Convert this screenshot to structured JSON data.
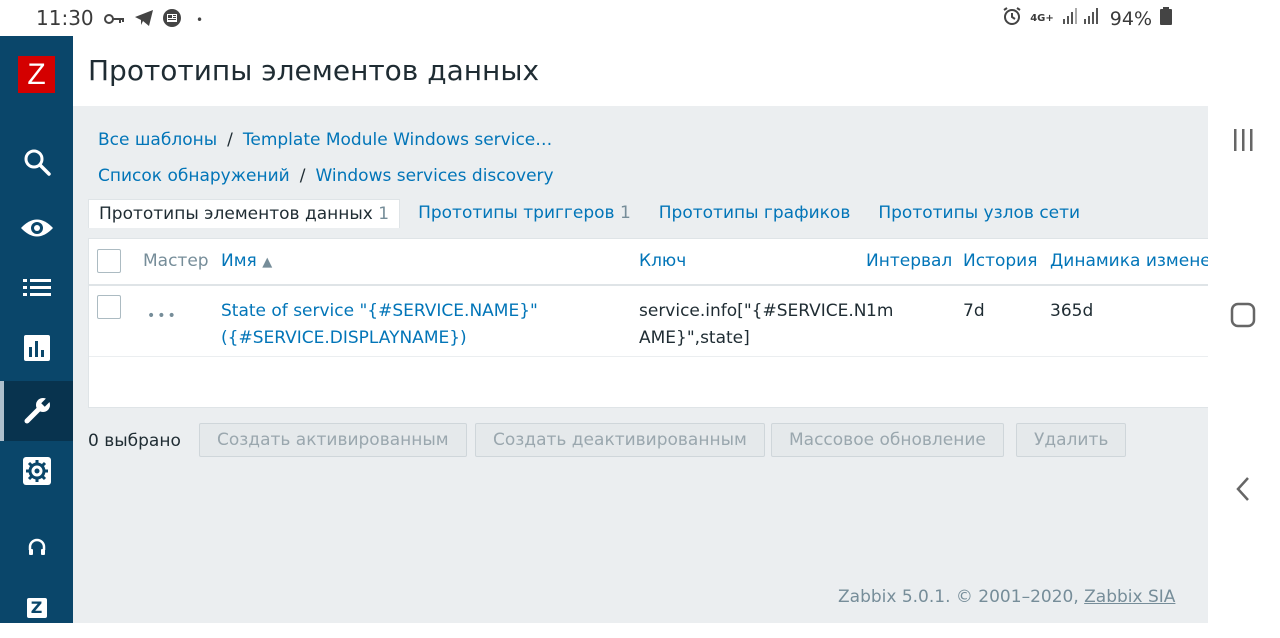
{
  "status_bar": {
    "time": "11:30",
    "network": "4G+",
    "battery": "94%",
    "icons": [
      "key-icon",
      "telegram-icon",
      "news-icon",
      "alarm-icon",
      "signal-icon",
      "battery-icon"
    ]
  },
  "sidebar": {
    "logo": "Z",
    "items": [
      {
        "name": "search"
      },
      {
        "name": "monitoring"
      },
      {
        "name": "inventory"
      },
      {
        "name": "reports"
      },
      {
        "name": "configuration",
        "active": true
      },
      {
        "name": "administration"
      },
      {
        "name": "support"
      },
      {
        "name": "zabbix-share",
        "label": "Z"
      }
    ]
  },
  "page": {
    "title": "Прототипы элементов данных"
  },
  "breadcrumbs": {
    "row1": [
      "Все шаблоны",
      "Template Module Windows service…"
    ],
    "row2": [
      "Список обнаружений",
      "Windows services discovery"
    ],
    "separator": "/"
  },
  "tabs": [
    {
      "label": "Прототипы элементов данных",
      "count": "1",
      "active": true
    },
    {
      "label": "Прототипы триггеров",
      "count": "1"
    },
    {
      "label": "Прототипы графиков",
      "count": ""
    },
    {
      "label": "Прототипы узлов сети",
      "count": ""
    }
  ],
  "table": {
    "headers": {
      "master": "Мастер",
      "name": "Имя",
      "key": "Ключ",
      "interval": "Интервал",
      "history": "История",
      "trends": "Динамика изменений"
    },
    "sort_indicator": "▲",
    "rows": [
      {
        "dots": "•••",
        "name_line1": "State of service \"{#SERVICE.NAME}\"",
        "name_line2": "({#SERVICE.DISPLAYNAME})",
        "key_line1": "service.info[\"{#SERVICE.N",
        "key_line2": "AME}\",state]",
        "interval": "1m",
        "history": "7d",
        "trends": "365d"
      }
    ]
  },
  "actions": {
    "selected": "0 выбрано",
    "enable": "Создать активированным",
    "disable": "Создать деактивированным",
    "mass_update": "Массовое обновление",
    "delete": "Удалить"
  },
  "footer": {
    "text": "Zabbix 5.0.1. © 2001–2020,",
    "link": "Zabbix SIA"
  },
  "colors": {
    "sidebar": "#0a466a",
    "link": "#0275b8",
    "logo": "#d40000",
    "content_bg": "#ebeef0"
  }
}
